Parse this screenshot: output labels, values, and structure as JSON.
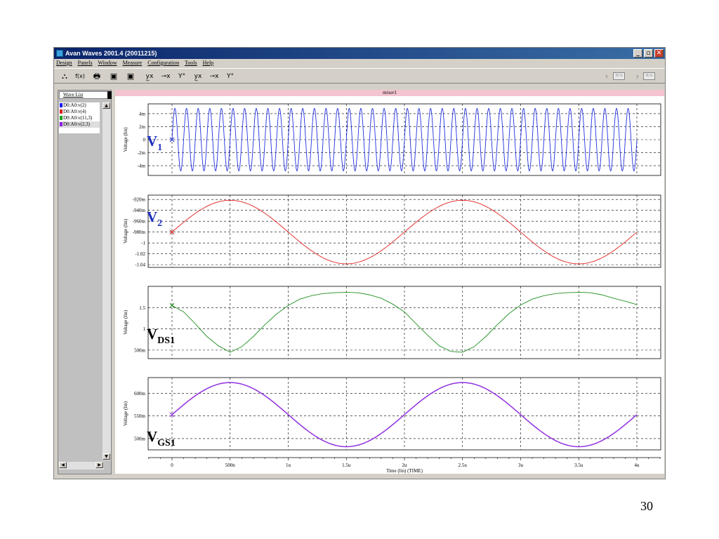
{
  "window": {
    "title": "Avan Waves 2001.4  (20011215)",
    "buttons": {
      "minimize": "_",
      "maximize": "▫",
      "close": "✕"
    }
  },
  "menu": [
    "Design",
    "Panels",
    "Window",
    "Measure",
    "Configuration",
    "Tools",
    "Help"
  ],
  "toolbar": {
    "icons": [
      "⛬",
      "f(x)",
      "🖶",
      "▣",
      "▣",
      "y̲x",
      "⊸x",
      "Y°",
      "y̲x",
      "⊸x",
      "Y°"
    ],
    "x_label": "x",
    "x_value": "N/A",
    "y_label": "y",
    "y_value": "N/A"
  },
  "wave_list": {
    "header": "Wave List",
    "items": [
      {
        "label": "D0:A0:v(2)",
        "color": "#1a1af0"
      },
      {
        "label": "D0:A0:v(4)",
        "color": "#e02020"
      },
      {
        "label": "D0:A0:v(11,3)",
        "color": "#20a020"
      },
      {
        "label": "D0:A0:v(2,3)",
        "color": "#9020e0"
      }
    ],
    "scroll_up": "▲",
    "scroll_down": "▼",
    "scroll_left": "◀",
    "scroll_right": "▶"
  },
  "panel_title": "mixer1",
  "slide_labels": {
    "v1": "V",
    "v1_sub": "1",
    "v2": "V",
    "v2_sub": "2",
    "vds1": "V",
    "vds1_sub": "DS1",
    "vgs1": "V",
    "vgs1_sub": "GS1"
  },
  "page_number": "30",
  "chart_data": [
    {
      "type": "line",
      "ylabel": "Voltage (lin)",
      "yticks": [
        "4m",
        "2m",
        "0",
        "-2m",
        "-4m"
      ],
      "ytick_values": [
        0.004,
        0.002,
        0,
        -0.002,
        -0.004
      ],
      "ylim": [
        -0.0055,
        0.0055
      ],
      "color": "#2030e0",
      "series": {
        "kind": "sine",
        "amplitude": 0.0048,
        "offset": 0,
        "frequency_hz": 10000000,
        "phase_deg": 0
      }
    },
    {
      "type": "line",
      "ylabel": "Voltage (lin)",
      "yticks": [
        "-920m",
        "-940m",
        "-960m",
        "-980m",
        "-1",
        "-1.02",
        "-1.04"
      ],
      "ytick_values": [
        -0.92,
        -0.94,
        -0.96,
        -0.98,
        -1.0,
        -1.02,
        -1.04
      ],
      "ylim": [
        -1.045,
        -0.912
      ],
      "color": "#e02020",
      "series": {
        "kind": "sine",
        "amplitude": 0.0585,
        "offset": -0.98,
        "frequency_hz": 500000,
        "phase_deg": 0
      }
    },
    {
      "type": "line",
      "ylabel": "Voltage (lin)",
      "yticks": [
        "1.5",
        "1",
        "500m"
      ],
      "ytick_values": [
        1.5,
        1.0,
        0.5
      ],
      "ylim": [
        0.3,
        2.0
      ],
      "color": "#209020",
      "series": {
        "kind": "points",
        "x": [
          0,
          1e-07,
          2e-07,
          3e-07,
          4e-07,
          5e-07,
          6e-07,
          7e-07,
          8e-07,
          9e-07,
          1e-06,
          1.1e-06,
          1.2e-06,
          1.3e-06,
          1.4e-06,
          1.5e-06,
          1.6e-06,
          1.7e-06,
          1.8e-06,
          1.9e-06,
          2e-06,
          2.1e-06,
          2.2e-06,
          2.3e-06,
          2.4e-06,
          2.5e-06,
          2.6e-06,
          2.7e-06,
          2.8e-06,
          2.9e-06,
          3e-06,
          3.1e-06,
          3.2e-06,
          3.3e-06,
          3.4e-06,
          3.5e-06,
          3.6e-06,
          3.7e-06,
          3.8e-06,
          3.9e-06,
          4e-06
        ],
        "y": [
          1.55,
          1.4,
          1.12,
          0.82,
          0.6,
          0.45,
          0.58,
          0.82,
          1.1,
          1.35,
          1.55,
          1.7,
          1.78,
          1.83,
          1.85,
          1.86,
          1.85,
          1.8,
          1.72,
          1.58,
          1.4,
          1.12,
          0.85,
          0.6,
          0.47,
          0.45,
          0.58,
          0.82,
          1.1,
          1.36,
          1.56,
          1.7,
          1.78,
          1.83,
          1.85,
          1.86,
          1.85,
          1.8,
          1.72,
          1.65,
          1.57
        ]
      }
    },
    {
      "type": "line",
      "ylabel": "Voltage (lin)",
      "yticks": [
        "600m",
        "550m",
        "500m"
      ],
      "ytick_values": [
        0.6,
        0.55,
        0.5
      ],
      "ylim": [
        0.475,
        0.635
      ],
      "color": "#9030e0",
      "series": {
        "kind": "sine",
        "amplitude": 0.071,
        "offset": 0.553,
        "frequency_hz": 500000,
        "phase_deg": 0
      }
    }
  ],
  "xaxis": {
    "xlabel": "Time (lin) (TIME)",
    "xticks": [
      "0",
      "500n",
      "1u",
      "1.5u",
      "2u",
      "2.5u",
      "3u",
      "3.5u",
      "4u"
    ],
    "xtick_values": [
      0,
      5e-07,
      1e-06,
      1.5e-06,
      2e-06,
      2.5e-06,
      3e-06,
      3.5e-06,
      4e-06
    ],
    "xlim": [
      0,
      4e-06
    ]
  }
}
